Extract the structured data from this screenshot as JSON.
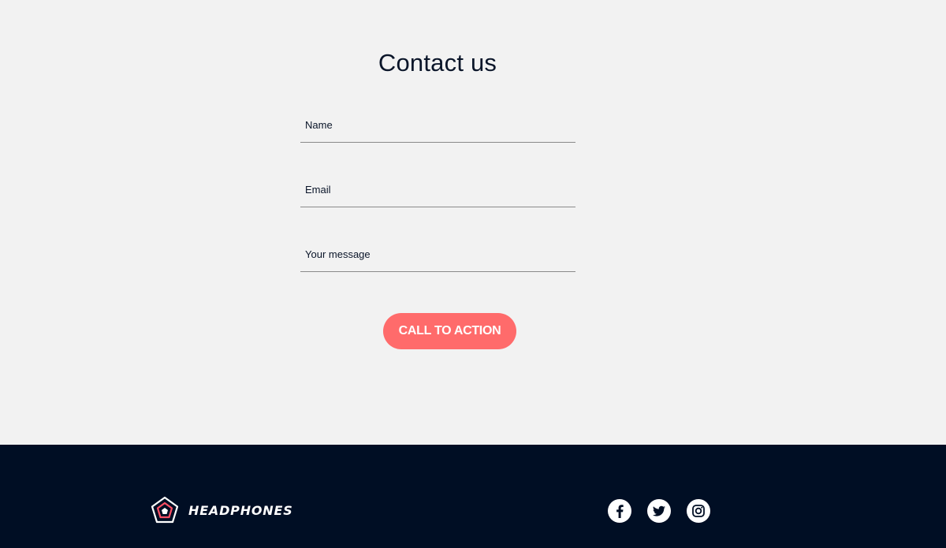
{
  "contact": {
    "title": "Contact us",
    "fields": {
      "name": {
        "label": "Name",
        "value": ""
      },
      "email": {
        "label": "Email",
        "value": ""
      },
      "message": {
        "label": "Your message",
        "value": ""
      }
    },
    "cta_label": "CALL TO ACTION"
  },
  "footer": {
    "brand": {
      "name": "HEADPHONES",
      "logo_icon": "pentagon-logo-icon"
    },
    "social": [
      {
        "name": "facebook",
        "icon": "facebook-icon"
      },
      {
        "name": "twitter",
        "icon": "twitter-icon"
      },
      {
        "name": "instagram",
        "icon": "instagram-icon"
      }
    ]
  },
  "colors": {
    "background": "#f2f2f2",
    "text": "#0a1529",
    "accent": "#ff6b6b",
    "footer": "#000e24",
    "underline": "#8a8a8a"
  }
}
